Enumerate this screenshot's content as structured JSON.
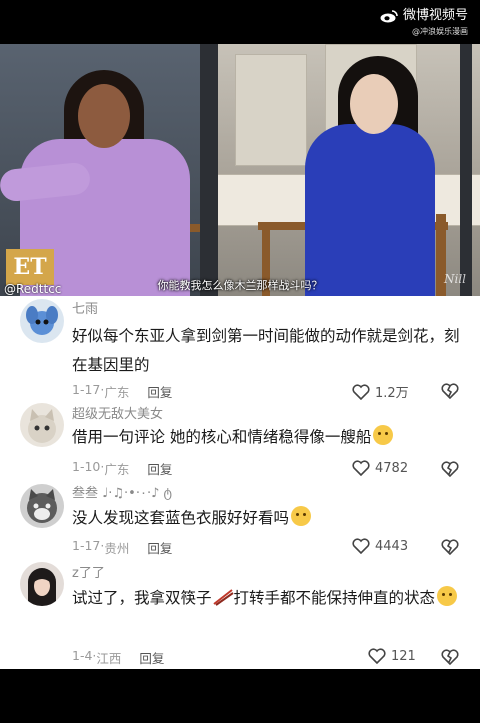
{
  "watermark": {
    "app": "微博视频号",
    "sub": "@冲浪娱乐漫画"
  },
  "video": {
    "subtitle": "你能教我怎么像木兰那样战斗吗？",
    "et_logo": "ET",
    "et_handle": "@Redttcc",
    "corner_mark": "Nill"
  },
  "comments": [
    {
      "user": "七雨",
      "text": "好似每个东亚人拿到剑第一时间能做的动作就是剑花，刻在基因里的",
      "date": "1-17",
      "location": "广东",
      "reply": "回复",
      "likes": "1.2万"
    },
    {
      "user": "超级无敌大美女",
      "text": "借用一句评论 她的核心和情绪稳得像一艘船",
      "date": "1-10",
      "location": "广东",
      "reply": "回复",
      "likes": "4782"
    },
    {
      "user": "叁叁 ♩·♫·•·٠·♪ ტ",
      "text": "没人发现这套蓝色衣服好好看吗",
      "date": "1-17",
      "location": "贵州",
      "reply": "回复",
      "likes": "4443"
    },
    {
      "user": "z了了",
      "text": "试过了，我拿双筷子",
      "text2": "打转手都不能保持伸直的状态",
      "date": "1-4",
      "location": "江西",
      "reply": "回复",
      "likes": "121"
    }
  ]
}
